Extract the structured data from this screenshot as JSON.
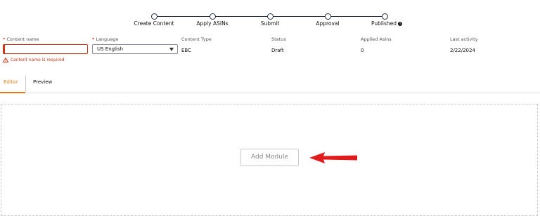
{
  "stepper": {
    "steps": [
      {
        "label": "Create Content"
      },
      {
        "label": "Apply ASINs"
      },
      {
        "label": "Submit"
      },
      {
        "label": "Approval"
      },
      {
        "label": "Published"
      }
    ],
    "info_icon_glyph": "i"
  },
  "form": {
    "content_name": {
      "required_mark": "*",
      "label": "Content name",
      "value": "",
      "error": "Content name is required"
    },
    "language": {
      "required_mark": "*",
      "label": "Language",
      "value": "US English"
    },
    "content_type": {
      "label": "Content Type",
      "value": "EBC"
    },
    "status": {
      "label": "Status",
      "value": "Draft"
    },
    "applied_asins": {
      "label": "Applied Asins",
      "value": "0"
    },
    "last_activity": {
      "label": "Last activity",
      "value": "2/22/2024"
    }
  },
  "tabs": {
    "editor": "Editor",
    "preview": "Preview",
    "active": "Editor"
  },
  "editor": {
    "add_module_label": "Add Module"
  },
  "colors": {
    "accent": "#e47911",
    "error": "#d13212",
    "arrow": "#e01b1b",
    "stepper_line": "#232f3e"
  },
  "icons": {
    "warning": "warning-triangle-icon",
    "info": "info-icon",
    "caret": "caret-down-icon",
    "arrow": "red-arrow-left-icon"
  }
}
